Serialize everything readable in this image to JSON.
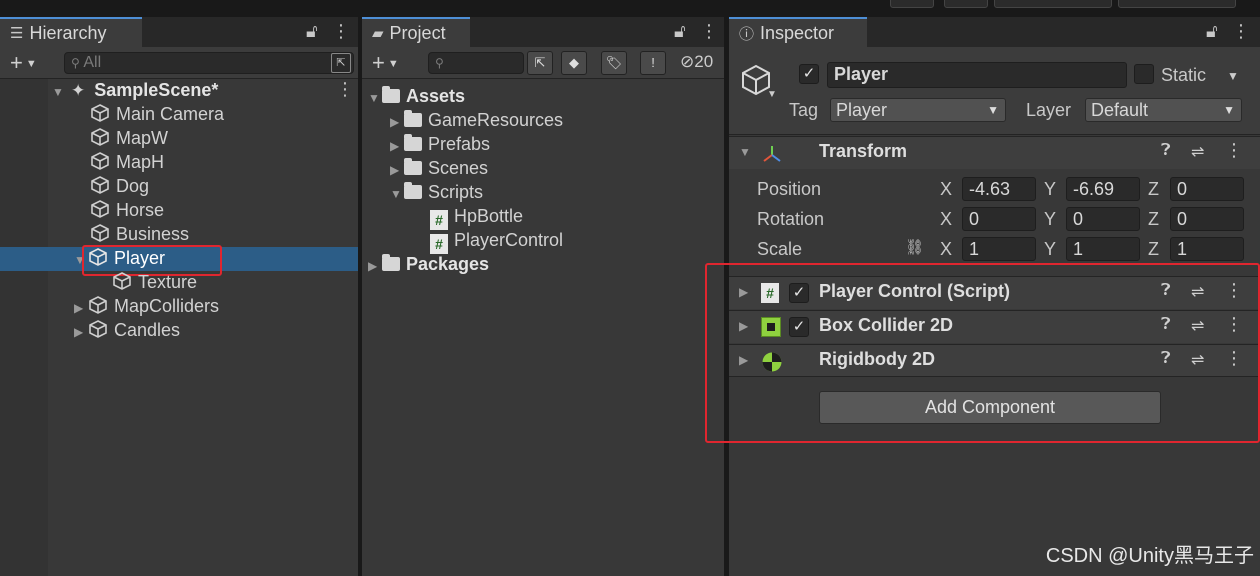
{
  "hierarchy": {
    "tab_title": "Hierarchy",
    "search_placeholder": "All",
    "scene_name": "SampleScene*",
    "items": [
      {
        "label": "Main Camera"
      },
      {
        "label": "MapW"
      },
      {
        "label": "MapH"
      },
      {
        "label": "Dog"
      },
      {
        "label": "Horse"
      },
      {
        "label": "Business"
      },
      {
        "label": "Player",
        "selected": true
      },
      {
        "label": "Texture"
      },
      {
        "label": "MapColliders"
      },
      {
        "label": "Candles"
      }
    ]
  },
  "project": {
    "tab_title": "Project",
    "hidden_count": "20",
    "root": "Assets",
    "folders": [
      "GameResources",
      "Prefabs",
      "Scenes",
      "Scripts"
    ],
    "scripts": [
      "HpBottle",
      "PlayerControl"
    ],
    "packages": "Packages"
  },
  "inspector": {
    "tab_title": "Inspector",
    "object_name": "Player",
    "static_label": "Static",
    "tag_label": "Tag",
    "tag_value": "Player",
    "layer_label": "Layer",
    "layer_value": "Default",
    "transform": {
      "title": "Transform",
      "position_label": "Position",
      "rotation_label": "Rotation",
      "scale_label": "Scale",
      "x": "X",
      "y": "Y",
      "z": "Z",
      "position": {
        "x": "-4.63",
        "y": "-6.69",
        "z": "0"
      },
      "rotation": {
        "x": "0",
        "y": "0",
        "z": "0"
      },
      "scale": {
        "x": "1",
        "y": "1",
        "z": "1"
      }
    },
    "components": [
      {
        "name": "Player Control (Script)"
      },
      {
        "name": "Box Collider 2D"
      },
      {
        "name": "Rigidbody 2D"
      }
    ],
    "add_component": "Add Component"
  },
  "watermark": "CSDN @Unity黑马王子",
  "colors": {
    "selection": "#2c5d87",
    "highlight_box": "#e0262f",
    "tab_accent": "#4e8fd6"
  }
}
